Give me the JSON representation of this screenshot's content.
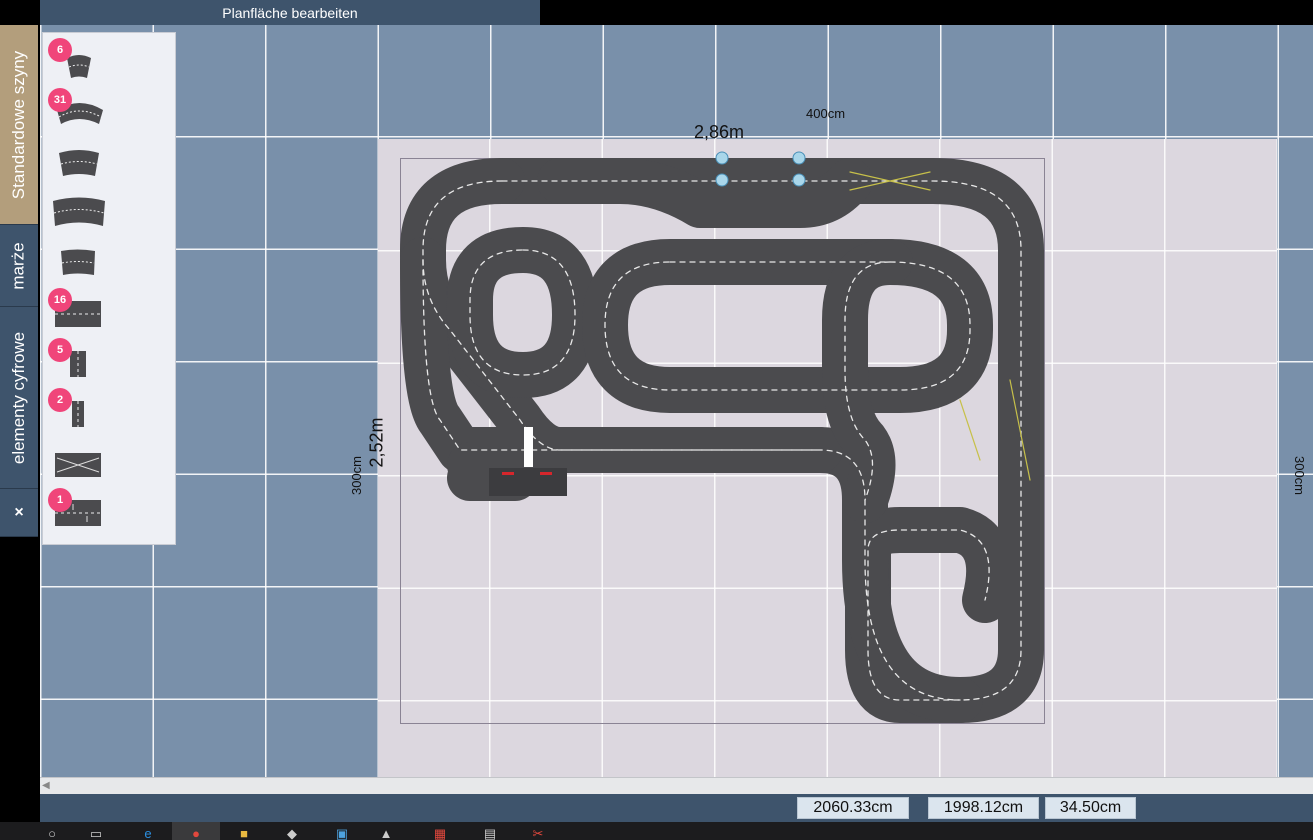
{
  "header": {
    "title": "Planfläche bearbeiten"
  },
  "sidebar": {
    "tabs": [
      {
        "label": "Standardowe szyny"
      },
      {
        "label": "marże"
      },
      {
        "label": "elementy cyfrowe"
      },
      {
        "label": "×"
      }
    ]
  },
  "palette": {
    "items": [
      {
        "name": "curve-tight",
        "badge": "6"
      },
      {
        "name": "curve-wide",
        "badge": "31"
      },
      {
        "name": "curve-medium",
        "badge": ""
      },
      {
        "name": "curve-outer",
        "badge": ""
      },
      {
        "name": "curve-small",
        "badge": ""
      },
      {
        "name": "straight-long",
        "badge": "16"
      },
      {
        "name": "straight-half",
        "badge": "5"
      },
      {
        "name": "straight-quarter",
        "badge": "2"
      },
      {
        "name": "crossing",
        "badge": ""
      },
      {
        "name": "lane-change",
        "badge": "1"
      }
    ]
  },
  "plan": {
    "top_width_cm": "400cm",
    "track_width_m": "2,86m",
    "left_height_cm": "300cm",
    "track_height_m": "2,52m",
    "right_height_cm": "300cm"
  },
  "status": {
    "x": "2060.33cm",
    "y": "1998.12cm",
    "zoom": "34.50cm"
  },
  "colors": {
    "track": "#4b4b4e",
    "badge": "#f0457a",
    "tab_active": "#b39e7c",
    "chrome": "#3e546c"
  },
  "taskbar": {
    "icons": [
      "search-icon",
      "task-view-icon",
      "edge-icon",
      "chrome-icon",
      "folder-icon",
      "store-icon",
      "photos-icon",
      "app-icon",
      "calendar-icon",
      "calculator-icon",
      "snip-icon"
    ]
  }
}
